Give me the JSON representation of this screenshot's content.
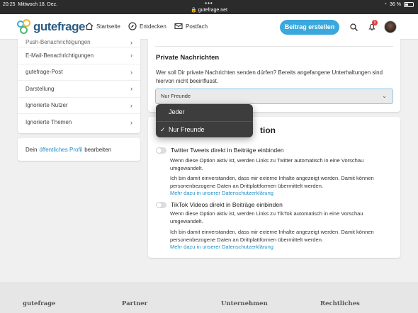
{
  "statusbar": {
    "time": "20:25",
    "date": "Mittwoch 18. Dez.",
    "dots": "•••",
    "url": "gutefrage.net",
    "battery": "36 %"
  },
  "header": {
    "logo": "gutefrage",
    "nav": [
      {
        "label": "Startseite",
        "icon": "home-icon"
      },
      {
        "label": "Entdecken",
        "icon": "compass-icon"
      },
      {
        "label": "Postfach",
        "icon": "mail-icon"
      }
    ],
    "post_button": "Beitrag erstellen",
    "notification_count": "1",
    "accent_color": "#3aa8dc"
  },
  "sidebar": {
    "items": [
      "Push-Benachrichtigungen",
      "E-Mail-Benachrichtigungen",
      "gutefrage-Post",
      "Darstellung",
      "Ignorierte Nutzer",
      "Ignorierte Themen"
    ],
    "profile": {
      "prefix": "Dein",
      "link": "öffentliches Profil",
      "suffix": "bearbeiten"
    }
  },
  "private_messages": {
    "title": "Private Nachrichten",
    "description": "Wer soll Dir private Nachrichten senden dürfen? Bereits angefangene Unterhaltungen sind hiervon nicht beeinflusst.",
    "selected": "Nur Freunde",
    "options": [
      "Jeder",
      "Nur Freunde"
    ]
  },
  "embeds": {
    "title_visible": "tion",
    "twitter": {
      "label": "Twitter Tweets direkt in Beiträge einbinden",
      "desc": "Wenn diese Option aktiv ist, werden Links zu Twitter automatisch in eine Vorschau umgewandelt.",
      "consent": "Ich bin damit einverstanden, dass mir externe Inhalte angezeigt werden. Damit können personenbezogene Daten an Drittplattformen übermittelt werden.",
      "link": "Mehr dazu in unserer Datenschutzerklärung"
    },
    "tiktok": {
      "label": "TikTok Videos direkt in Beiträge einbinden",
      "desc": "Wenn diese Option aktiv ist, werden Links zu TikTok automatisch in eine Vorschau umgewandelt.",
      "consent": "Ich bin damit einverstanden, dass mir externe Inhalte angezeigt werden. Damit können personenbezogene Daten an Drittplattformen übermittelt werden.",
      "link": "Mehr dazu in unserer Datenschutzerklärung"
    }
  },
  "footer": {
    "columns": [
      "gutefrage",
      "Partner",
      "Unternehmen",
      "Rechtliches"
    ]
  }
}
